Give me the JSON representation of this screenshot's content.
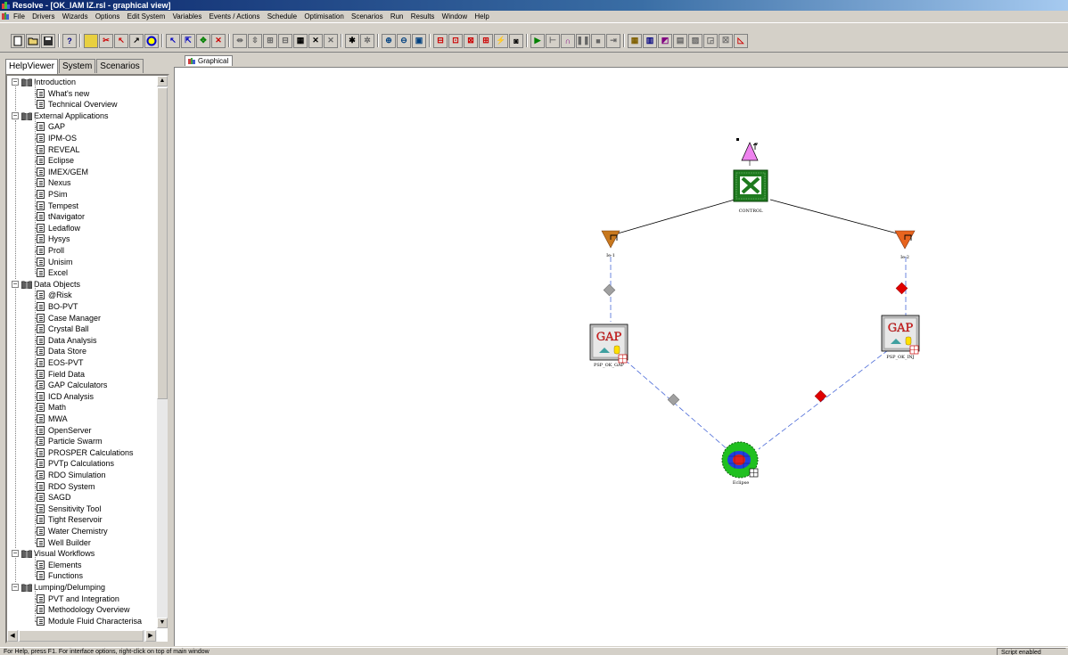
{
  "window": {
    "title": "Resolve - [OK_IAM IZ.rsl - graphical view]"
  },
  "menu": {
    "items": [
      "File",
      "Drivers",
      "Wizards",
      "Options",
      "Edit System",
      "Variables",
      "Events / Actions",
      "Schedule",
      "Optimisation",
      "Scenarios",
      "Run",
      "Results",
      "Window",
      "Help"
    ]
  },
  "left_panel": {
    "tabs": [
      "HelpViewer",
      "System",
      "Scenarios"
    ],
    "active_tab": "HelpViewer",
    "tree": {
      "introduction": {
        "label": "Introduction",
        "children": [
          "What's new",
          "Technical Overview"
        ]
      },
      "external_applications": {
        "label": "External Applications",
        "children": [
          "GAP",
          "IPM-OS",
          "REVEAL",
          "Eclipse",
          "IMEX/GEM",
          "Nexus",
          "PSim",
          "Tempest",
          "tNavigator",
          "Ledaflow",
          "Hysys",
          "Proll",
          "Unisim",
          "Excel"
        ]
      },
      "data_objects": {
        "label": "Data Objects",
        "children": [
          "@Risk",
          "BO-PVT",
          "Case Manager",
          "Crystal Ball",
          "Data Analysis",
          "Data Store",
          "EOS-PVT",
          "Field Data",
          "GAP Calculators",
          "ICD Analysis",
          "Math",
          "MWA",
          "OpenServer",
          "Particle Swarm",
          "PROSPER Calculations",
          "PVTp Calculations",
          "RDO Simulation",
          "RDO System",
          "SAGD",
          "Sensitivity Tool",
          "Tight Reservoir",
          "Water Chemistry",
          "Well Builder"
        ]
      },
      "visual_workflows": {
        "label": "Visual Workflows",
        "children": [
          "Elements",
          "Functions"
        ]
      },
      "lumping": {
        "label": "Lumping/Delumping",
        "children": [
          "PVT and Integration",
          "Methodology Overview",
          "Module Fluid Characterisa"
        ]
      }
    }
  },
  "doc_tab": {
    "label": "Graphical"
  },
  "diagram": {
    "nodes": {
      "control": {
        "label": "CONTROL"
      },
      "ie1": {
        "label": "Ie-1"
      },
      "ie2": {
        "label": "Ie-2"
      },
      "gap_left": {
        "label": "PSP_OK_GAP",
        "badge": "GAP"
      },
      "gap_right": {
        "label": "PSP_OK_INJ",
        "badge": "GAP"
      },
      "eclipse": {
        "label": "Eclipse"
      }
    },
    "colors": {
      "excel_green": "#1e7a1e",
      "trigger_pink": "#ee82ee",
      "triangle_orange": "#c8781e",
      "triangle_red_orange": "#e8641e",
      "diamond_grey": "#a0a0a0",
      "diamond_red": "#e00000",
      "link_blue": "#4a6ad8"
    }
  },
  "status": {
    "help": "For Help, press F1. For interface options, right-click on top of main window",
    "script": "Script enabled"
  }
}
